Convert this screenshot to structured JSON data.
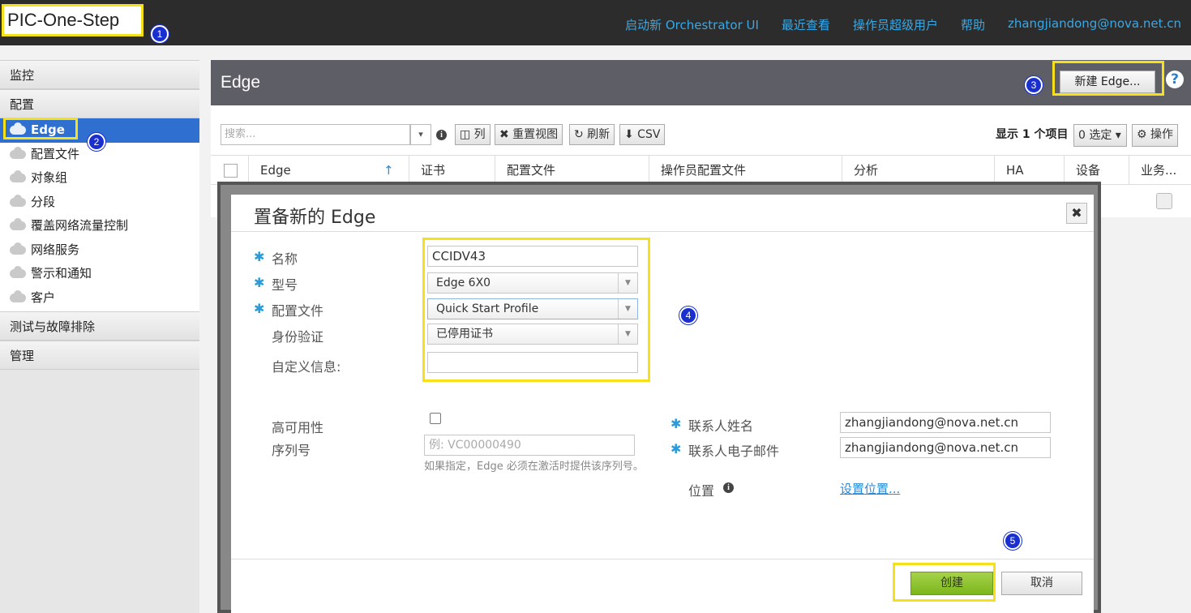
{
  "app": {
    "title": "PIC-One-Step"
  },
  "topnav": [
    {
      "label": "启动新 Orchestrator UI"
    },
    {
      "label": "最近查看"
    },
    {
      "label": "操作员超级用户"
    },
    {
      "label": "帮助"
    },
    {
      "label": "zhangjiandong@nova.net.cn"
    }
  ],
  "markers": [
    "1",
    "2",
    "3",
    "4",
    "5"
  ],
  "sidebar": {
    "monitor": "监控",
    "config": "配置",
    "items": [
      {
        "label": "Edge",
        "active": true
      },
      {
        "label": "配置文件"
      },
      {
        "label": "对象组"
      },
      {
        "label": "分段"
      },
      {
        "label": "覆盖网络流量控制"
      },
      {
        "label": "网络服务"
      },
      {
        "label": "警示和通知"
      },
      {
        "label": "客户"
      }
    ],
    "test": "测试与故障排除",
    "admin": "管理"
  },
  "main": {
    "title": "Edge",
    "new_button": "新建 Edge...",
    "help": "?"
  },
  "toolbar": {
    "search_placeholder": "搜索...",
    "info": "i",
    "columns": "◫ 列",
    "reset_view": "✖ 重置视图",
    "refresh": "↻ 刷新",
    "csv": "⬇ CSV",
    "count": "显示 1 个项目",
    "selected": "0 选定 ▾",
    "actions": "⚙ 操作"
  },
  "table": {
    "columns": [
      "Edge",
      "证书",
      "配置文件",
      "操作员配置文件",
      "分析",
      "HA",
      "设备",
      "业务..."
    ],
    "sort_icon": "↑"
  },
  "modal": {
    "title": "置备新的 Edge",
    "close": "✖",
    "required_mark": "✱",
    "fields": {
      "name_label": "名称",
      "name_value": "CCIDV43",
      "model_label": "型号",
      "model_value": "Edge 6X0",
      "profile_label": "配置文件",
      "profile_value": "Quick Start Profile",
      "auth_label": "身份验证",
      "auth_value": "已停用证书",
      "custom_label": "自定义信息:",
      "custom_value": "",
      "ha_label": "高可用性",
      "serial_label": "序列号",
      "serial_placeholder": "例: VC00000490",
      "serial_hint": "如果指定，Edge 必须在激活时提供该序列号。",
      "contact_name_label": "联系人姓名",
      "contact_name_value": "zhangjiandong@nova.net.cn",
      "contact_email_label": "联系人电子邮件",
      "contact_email_value": "zhangjiandong@nova.net.cn",
      "location_label": "位置",
      "location_link": "设置位置..."
    },
    "create": "创建",
    "cancel": "取消"
  },
  "colors": {
    "topbar": "#2c2c2c",
    "link": "#3aa8e4",
    "active_nav": "#2f6fcf",
    "highlight": "#f5e01a",
    "create_button": "#8cc33a"
  }
}
